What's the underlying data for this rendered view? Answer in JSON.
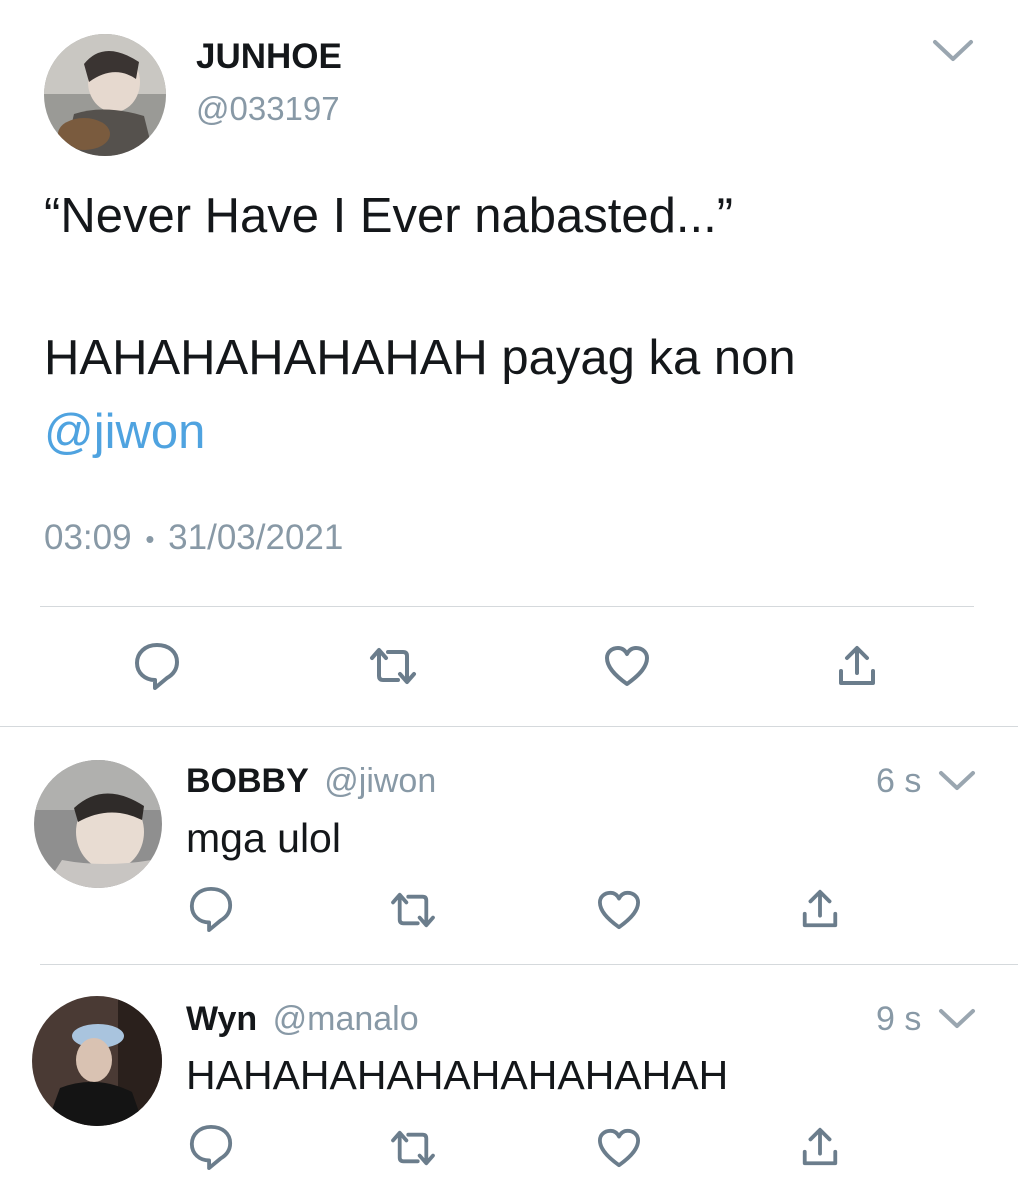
{
  "main_tweet": {
    "display_name": "JUNHOE",
    "handle": "@033197",
    "line1": "“Never Have I Ever nabasted...”",
    "line2": "HAHAHAHAHAHAH payag ka non",
    "mention": "@jiwon",
    "time": "03:09",
    "separator": "•",
    "date": "31/03/2021"
  },
  "replies": [
    {
      "display_name": "BOBBY",
      "handle": "@jiwon",
      "text": "mga ulol",
      "age": "6 s"
    },
    {
      "display_name": "Wyn",
      "handle": "@manalo",
      "text": "HAHAHAHAHAHAHAHAHAH",
      "age": "9 s"
    }
  ],
  "icons": {
    "reply": "speech-bubble-icon",
    "retweet": "retweet-icon",
    "like": "heart-icon",
    "share": "share-icon",
    "menu": "chevron-down-icon"
  },
  "colors": {
    "link": "#4fa3e0",
    "icon_grey": "#6b7d8c",
    "divider": "#d5d9dc"
  }
}
